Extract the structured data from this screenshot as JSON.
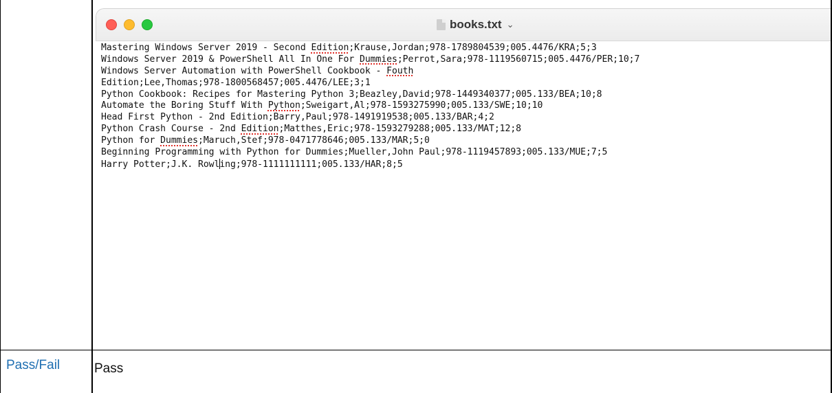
{
  "window": {
    "filename": "books.txt",
    "title_chevron": "⌄"
  },
  "icons": {
    "file": "document-icon",
    "close": "close-button",
    "minimize": "minimize-button",
    "zoom": "zoom-button"
  },
  "colors": {
    "close": "#ff5f57",
    "minimize": "#febc2e",
    "zoom": "#28c840",
    "label": "#1f6fb2",
    "spellcheck": "#e0302a"
  },
  "editor": {
    "lines": [
      {
        "pre": "Mastering Windows Server 2019 - Second ",
        "sp": "Edition",
        "post": ";Krause,Jordan;978-1789804539;005.4476/KRA;5;3"
      },
      {
        "pre": "Windows Server 2019 & PowerShell All In One For ",
        "sp": "Dummies",
        "post": ";Perrot,Sara;978-1119560715;005.4476/PER;10;7"
      },
      {
        "pre": "Windows Server Automation with PowerShell Cookbook - ",
        "sp": "Fouth",
        "post": ""
      },
      {
        "pre": "",
        "sp": "",
        "post": "Edition;Lee,Thomas;978-1800568457;005.4476/LEE;3;1"
      },
      {
        "pre": "Python Cookbook: Recipes for Mastering Python 3;Beazley,David;978-1449340377;005.133/BEA;10;8",
        "sp": "",
        "post": ""
      },
      {
        "pre": "Automate the Boring Stuff With ",
        "sp": "Python",
        "post": ";Sweigart,Al;978-1593275990;005.133/SWE;10;10"
      },
      {
        "pre": "Head First Python - 2nd Edition;Barry,Paul;978-1491919538;005.133/BAR;4;2",
        "sp": "",
        "post": ""
      },
      {
        "pre": "Python Crash Course - 2nd ",
        "sp": "Edition",
        "post": ";Matthes,Eric;978-1593279288;005.133/MAT;12;8"
      },
      {
        "pre": "Python for ",
        "sp": "Dummies",
        "post": ";Maruch,Stef;978-0471778646;005.133/MAR;5;0"
      },
      {
        "pre": "Beginning Programming with Python for Dummies;Mueller,John Paul;978-1119457893;005.133/MUE;7;5",
        "sp": "",
        "post": ""
      },
      {
        "pre": "Harry Potter;J.K. Rowl",
        "cursor": true,
        "sp": "",
        "post": "ing;978-1111111111;005.133/HAR;8;5"
      }
    ]
  },
  "result": {
    "label": "Pass/Fail",
    "value": "Pass"
  }
}
